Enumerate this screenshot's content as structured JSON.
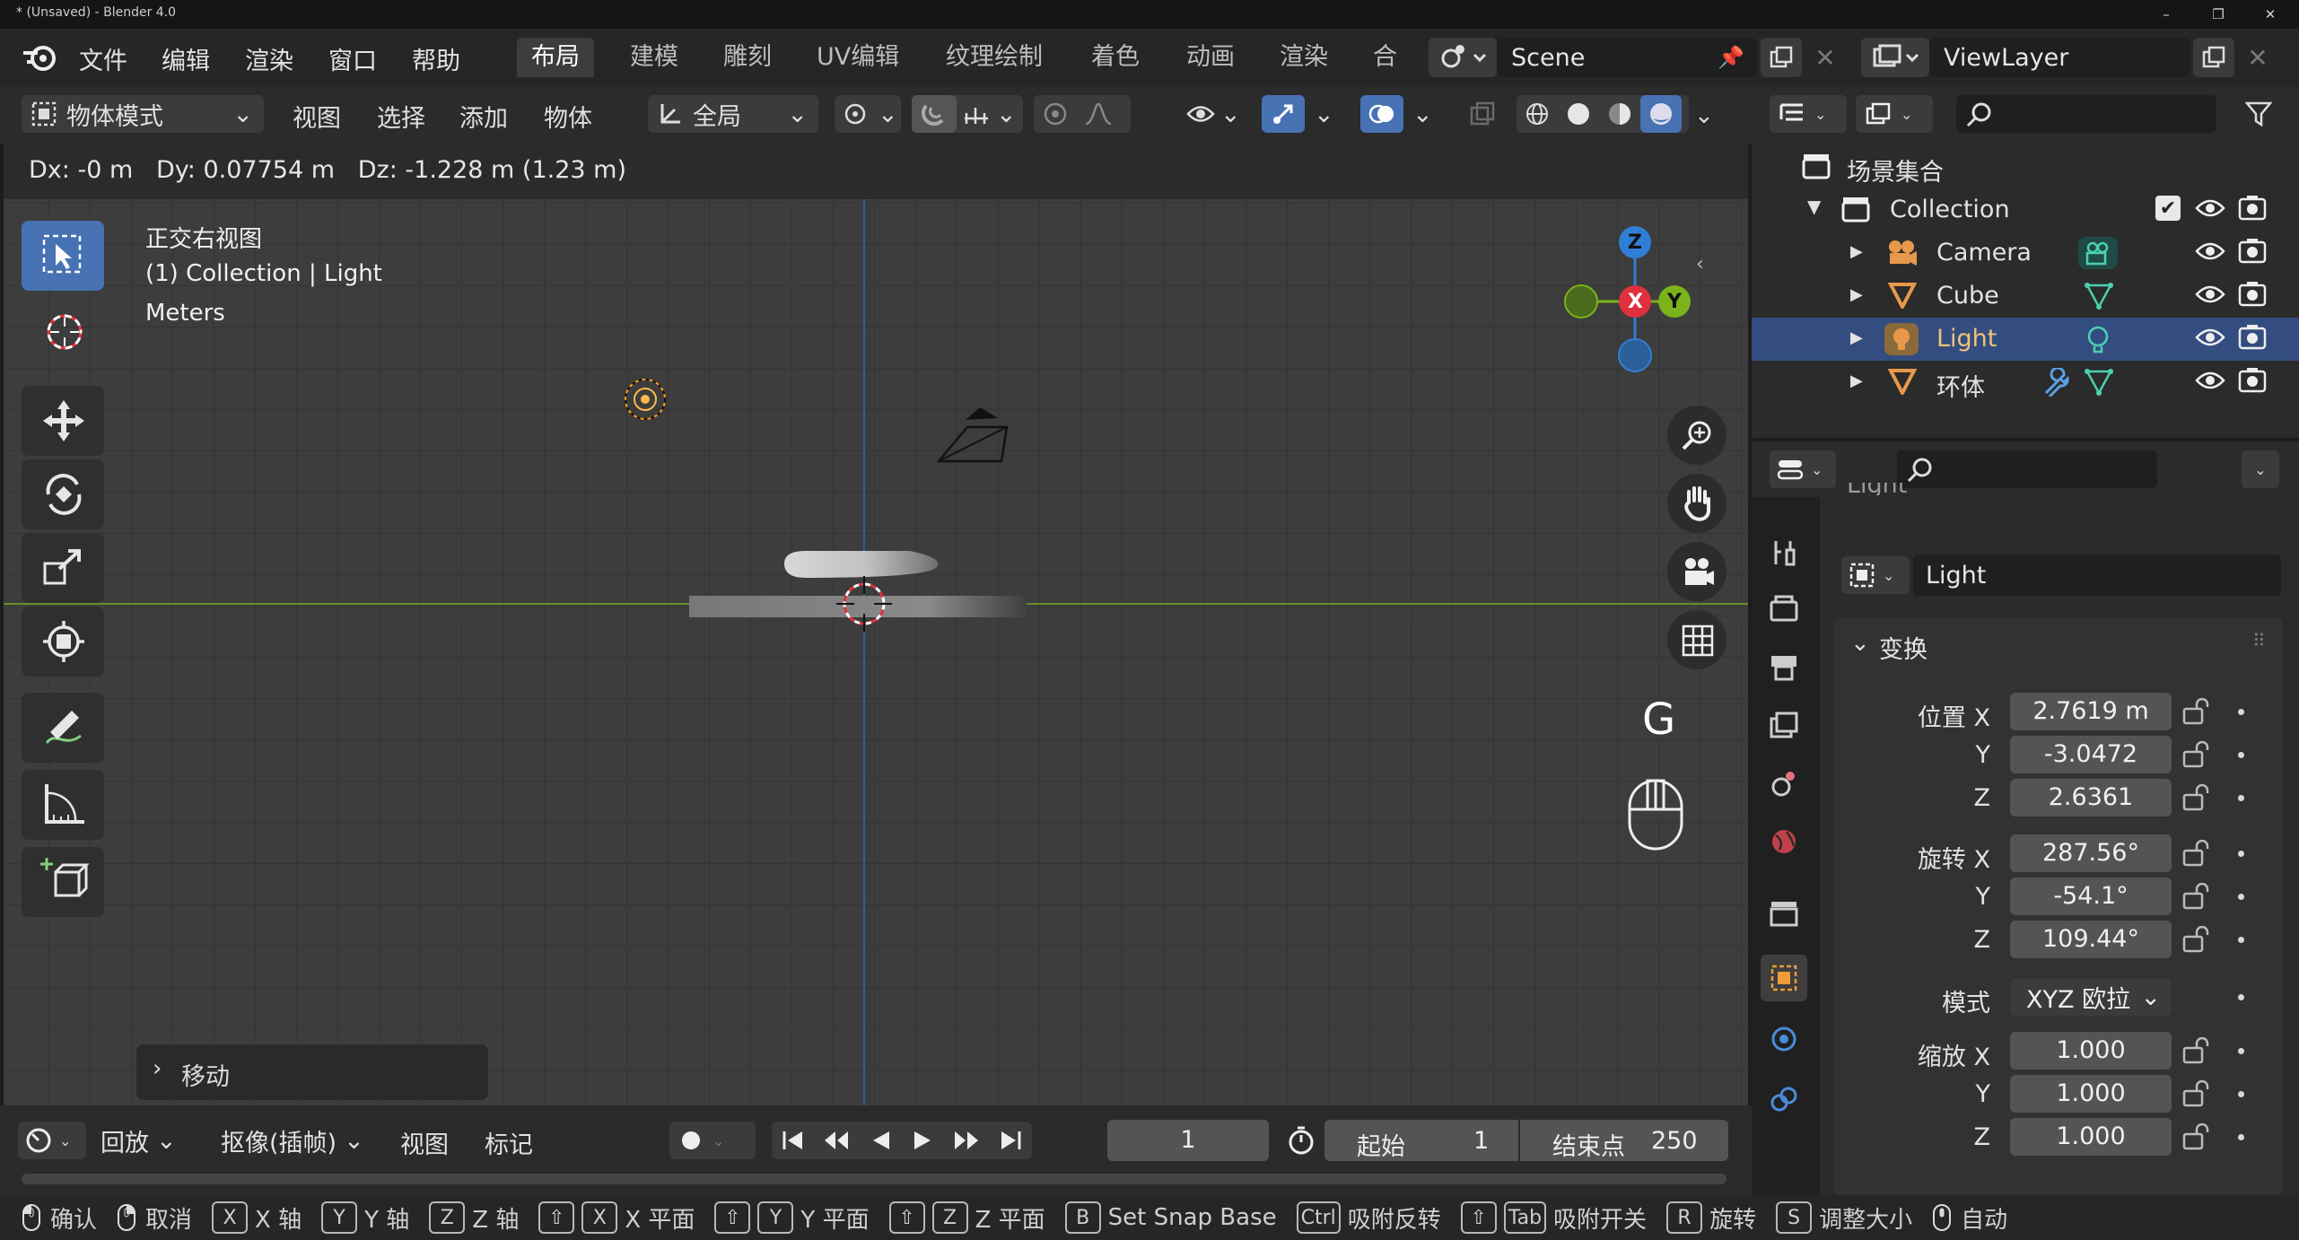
{
  "window": {
    "title": "* (Unsaved) - Blender 4.0"
  },
  "menu": [
    "文件",
    "编辑",
    "渲染",
    "窗口",
    "帮助"
  ],
  "workspaces": [
    "布局",
    "建模",
    "雕刻",
    "UV编辑",
    "纹理绘制",
    "着色",
    "动画",
    "渲染",
    "合成"
  ],
  "scene": {
    "name": "Scene",
    "view_layer": "ViewLayer"
  },
  "header": {
    "mode": "物体模式",
    "menus": [
      "视图",
      "选择",
      "添加",
      "物体"
    ],
    "orientation": "全局"
  },
  "viewport": {
    "delta_readout": "Dx: -0 m   Dy: 0.07754 m   Dz: -1.228 m (1.23 m)",
    "view_name": "正交右视图",
    "collection_line": "(1) Collection | Light",
    "units": "Meters",
    "gizmo": {
      "z": "Z",
      "x": "X",
      "y": "Y"
    },
    "key_hint": "G",
    "operator_panel": "移动"
  },
  "timeline": {
    "playback": "回放",
    "keying": "抠像(插帧)",
    "view": "视图",
    "marker": "标记",
    "current_frame": "1",
    "start_label": "起始",
    "start": "1",
    "end_label": "结束点",
    "end": "250"
  },
  "statusbar": [
    {
      "keys": [],
      "mouse": "left",
      "label": "确认"
    },
    {
      "keys": [],
      "mouse": "right",
      "label": "取消"
    },
    {
      "keys": [
        "X"
      ],
      "label": "X 轴"
    },
    {
      "keys": [
        "Y"
      ],
      "label": "Y 轴"
    },
    {
      "keys": [
        "Z"
      ],
      "label": "Z 轴"
    },
    {
      "keys": [
        "⇧",
        "X"
      ],
      "label": "X 平面"
    },
    {
      "keys": [
        "⇧",
        "Y"
      ],
      "label": "Y 平面"
    },
    {
      "keys": [
        "⇧",
        "Z"
      ],
      "label": "Z 平面"
    },
    {
      "keys": [
        "B"
      ],
      "label": "Set Snap Base"
    },
    {
      "keys": [
        "Ctrl"
      ],
      "label": "吸附反转"
    },
    {
      "keys": [
        "⇧",
        "Tab"
      ],
      "label": "吸附开关"
    },
    {
      "keys": [
        "R"
      ],
      "label": "旋转"
    },
    {
      "keys": [
        "S"
      ],
      "label": "调整大小"
    },
    {
      "keys": [],
      "mouse": "middle",
      "label": "自动"
    }
  ],
  "outliner": {
    "root": "场景集合",
    "collection": "Collection",
    "items": [
      {
        "name": "Camera",
        "type": "camera"
      },
      {
        "name": "Cube",
        "type": "mesh"
      },
      {
        "name": "Light",
        "type": "light",
        "selected": true
      },
      {
        "name": "环体",
        "type": "mesh"
      }
    ]
  },
  "properties": {
    "header_partial": "Light",
    "object_name": "Light",
    "section": "变换",
    "location_label": "位置 X",
    "rotation_label": "旋转 X",
    "scale_label": "缩放 X",
    "y_label": "Y",
    "z_label": "Z",
    "location": [
      "2.7619 m",
      "-3.0472",
      "2.6361"
    ],
    "rotation": [
      "287.56°",
      "-54.1°",
      "109.44°"
    ],
    "mode_label": "模式",
    "mode_value": "XYZ 欧拉",
    "scale": [
      "1.000",
      "1.000",
      "1.000"
    ]
  },
  "colors": {
    "accent": "#4772b3",
    "x_axis": "#e0303e",
    "y_axis": "#7bb31a",
    "z_axis": "#2f7fd6",
    "selection_row": "#334d80"
  }
}
